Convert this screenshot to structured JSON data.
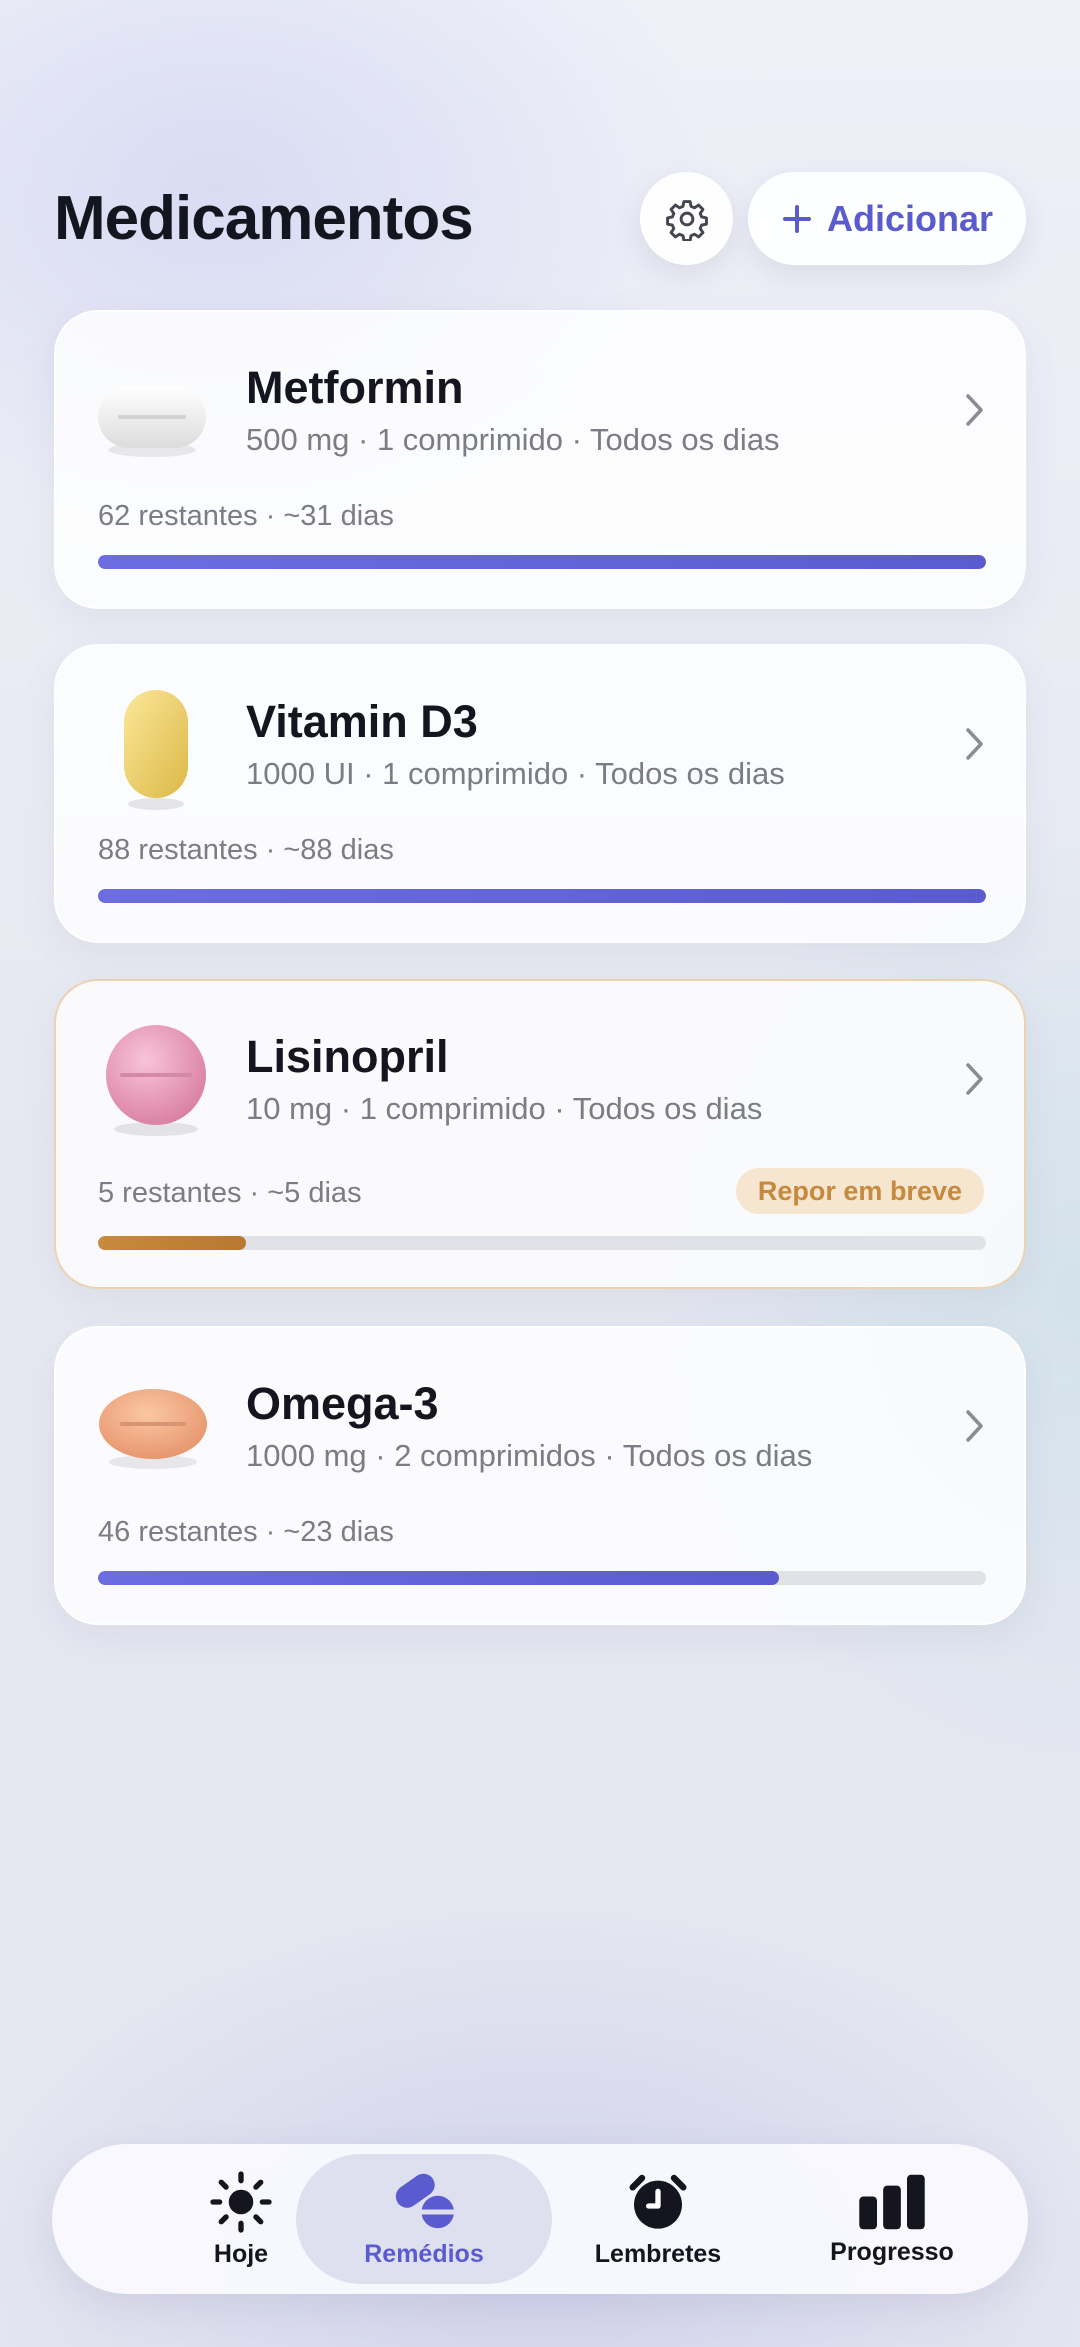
{
  "header": {
    "title": "Medicamentos",
    "settings_icon": "gear-icon",
    "add_label": "Adicionar",
    "add_icon": "plus-icon"
  },
  "medications": [
    {
      "name": "Metformin",
      "detail": "500 mg · 1 comprimido · Todos os dias",
      "remaining": "62 restantes · ~31 dias",
      "progress": 1.0,
      "pill_icon": "white-oval-pill-icon",
      "badge": ""
    },
    {
      "name": "Vitamin D3",
      "detail": "1000 UI · 1 comprimido · Todos os dias",
      "remaining": "88 restantes · ~88 dias",
      "progress": 1.0,
      "pill_icon": "yellow-capsule-icon",
      "badge": ""
    },
    {
      "name": "Lisinopril",
      "detail": "10 mg · 1 comprimido · Todos os dias",
      "remaining": "5 restantes · ~5 dias",
      "progress": 0.167,
      "pill_icon": "pink-round-pill-icon",
      "badge": "Repor em breve"
    },
    {
      "name": "Omega-3",
      "detail": "1000 mg · 2 comprimidos · Todos os dias",
      "remaining": "46 restantes · ~23 dias",
      "progress": 0.767,
      "pill_icon": "orange-oval-pill-icon",
      "badge": ""
    }
  ],
  "colors": {
    "accent": "#5b5bd0",
    "warning": "#c58a3e",
    "warning_bg": "#f6e5cf"
  },
  "tabs": [
    {
      "label": "Hoje",
      "icon": "sun-icon",
      "active": false
    },
    {
      "label": "Remédios",
      "icon": "pills-icon",
      "active": true
    },
    {
      "label": "Lembretes",
      "icon": "alarm-clock-icon",
      "active": false
    },
    {
      "label": "Progresso",
      "icon": "bar-chart-icon",
      "active": false
    }
  ]
}
